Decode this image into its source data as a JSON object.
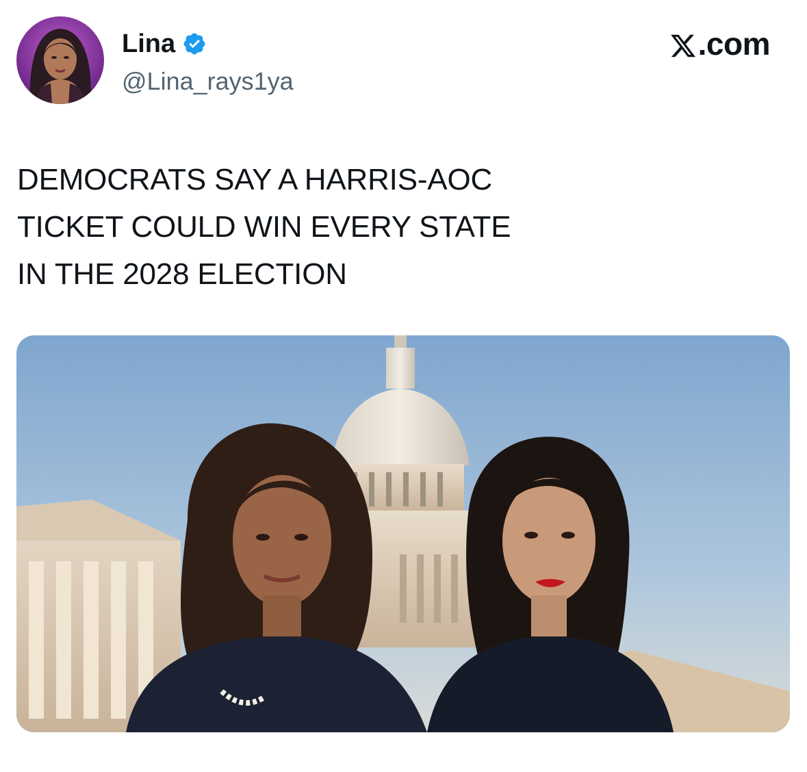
{
  "tweet": {
    "display_name": "Lina",
    "handle": "@Lina_rays1ya",
    "brand_suffix": ".com",
    "text_lines": [
      "DEMOCRATS SAY A HARRIS-AOC",
      "TICKET COULD WIN EVERY STATE",
      "IN THE 2028 ELECTION"
    ]
  },
  "icons": {
    "verified": "verified-badge-icon",
    "brand": "x-logo-icon"
  },
  "colors": {
    "verified_blue": "#1d9bf0",
    "handle_gray": "#536471",
    "text": "#0f1419",
    "avatar_purple": "#8a3aa8"
  }
}
